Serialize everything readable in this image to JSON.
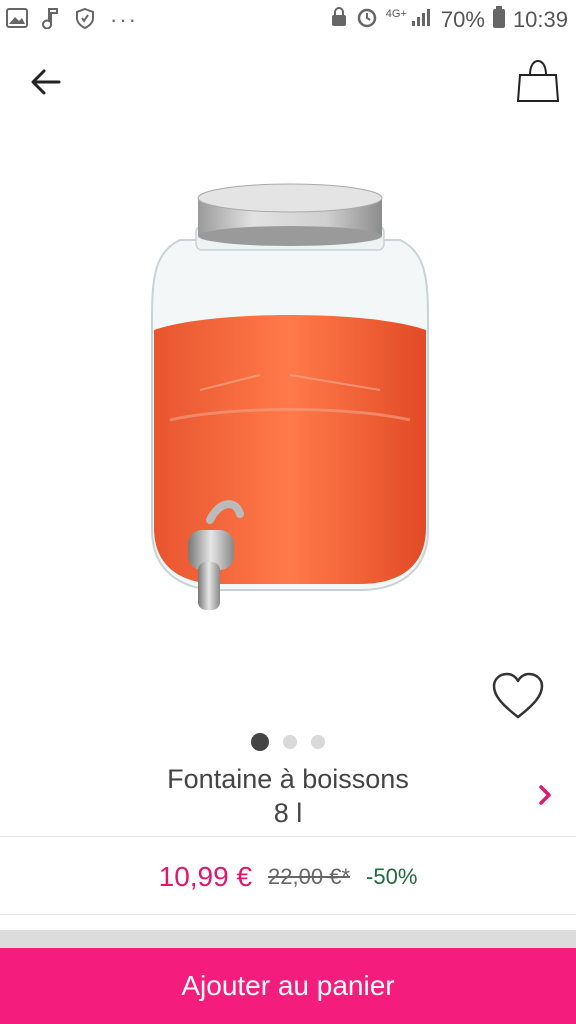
{
  "status_bar": {
    "left_icons": [
      "gallery-icon",
      "music-note-icon",
      "hand-shield-icon"
    ],
    "more": "···",
    "network": "4G+",
    "battery": "70%",
    "time": "10:39"
  },
  "header": {
    "back_icon": "arrow-left-icon",
    "cart_icon": "shopping-bag-icon"
  },
  "gallery": {
    "current_page": 1,
    "page_count": 3,
    "favorite_icon": "heart-outline-icon"
  },
  "product": {
    "title_line1": "Fontaine à boissons",
    "title_line2": "8 l",
    "detail_icon": "chevron-right-icon"
  },
  "price": {
    "current": "10,99 €",
    "old": "22,00 €*",
    "discount": "-50%"
  },
  "cta": {
    "label": "Ajouter au panier"
  },
  "colors": {
    "accent": "#f41c7d",
    "price": "#e0176c",
    "discount": "#1f6b3f"
  }
}
